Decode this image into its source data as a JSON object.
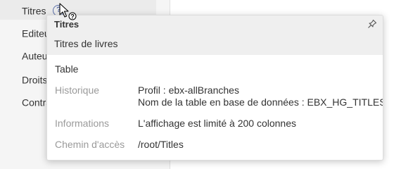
{
  "nav": {
    "items": [
      {
        "label": "Titres",
        "selected": true
      },
      {
        "label": "Editeurs"
      },
      {
        "label": "Auteurs"
      },
      {
        "label": "Droits"
      },
      {
        "label": "Contrats"
      }
    ],
    "help_glyph": "?"
  },
  "tooltip": {
    "title": "Titres",
    "subtitle": "Titres de livres",
    "type": "Table",
    "rows": [
      {
        "label": "Historique",
        "lines": [
          "Profil : ebx-allBranches",
          "Nom de la table en base de données : EBX_HG_TITLES"
        ]
      },
      {
        "label": "Informations",
        "lines": [
          "L'affichage est limité à 200 colonnes"
        ]
      },
      {
        "label": "Chemin d'accès",
        "lines": [
          "/root/Titles"
        ]
      }
    ]
  },
  "icons": {
    "help": "help-circle-icon",
    "pin": "pin-icon",
    "cursor": "help-cursor-icon"
  },
  "colors": {
    "help_accent": "#5a6ea8",
    "secondary_text": "#9a9a9a"
  }
}
